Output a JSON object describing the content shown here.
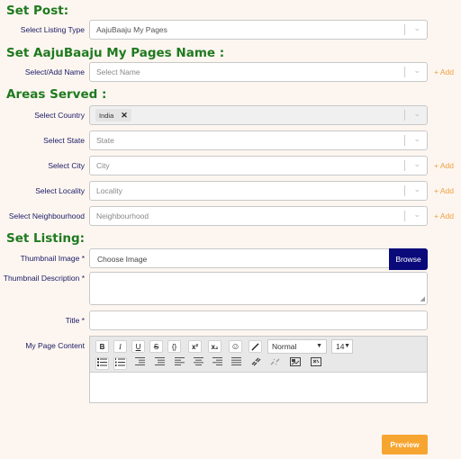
{
  "sections": {
    "set_post": "Set Post:",
    "pages_name": "Set AajuBaaju My Pages Name :",
    "areas_served": "Areas Served :",
    "set_listing": "Set Listing:"
  },
  "fields": {
    "listing_type": {
      "label": "Select Listing Type",
      "value": "AajuBaaju My Pages"
    },
    "add_name": {
      "label": "Select/Add Name",
      "placeholder": "Select Name",
      "add": "+ Add"
    },
    "country": {
      "label": "Select Country",
      "value": "India"
    },
    "state": {
      "label": "Select State",
      "placeholder": "State"
    },
    "city": {
      "label": "Select City",
      "placeholder": "City",
      "add": "+ Add"
    },
    "locality": {
      "label": "Select Locality",
      "placeholder": "Locality",
      "add": "+ Add"
    },
    "neighbourhood": {
      "label": "Select Neighbourhood",
      "placeholder": "Neighbourhood",
      "add": "+ Add"
    },
    "thumbnail_image": {
      "label": "Thumbnail Image *",
      "text": "Choose Image",
      "browse": "Browse"
    },
    "thumbnail_description": {
      "label": "Thumbnail Description *"
    },
    "title": {
      "label": "Title *"
    },
    "content": {
      "label": "My Page Content"
    }
  },
  "editor": {
    "bold": "B",
    "italic": "I",
    "underline": "U",
    "strike": "S",
    "code": "{}",
    "superscript": "x²",
    "subscript": "x₂",
    "emoji": "☺",
    "brush": "🖌",
    "format": "Normal",
    "font_size": "14",
    "caret": "▼"
  },
  "colors": {
    "heading": "#1f7a1f",
    "label": "#1a1a66",
    "add": "#f0a040",
    "browse": "#0a0a7a",
    "preview": "#f7a531"
  },
  "buttons": {
    "preview": "Preview"
  }
}
